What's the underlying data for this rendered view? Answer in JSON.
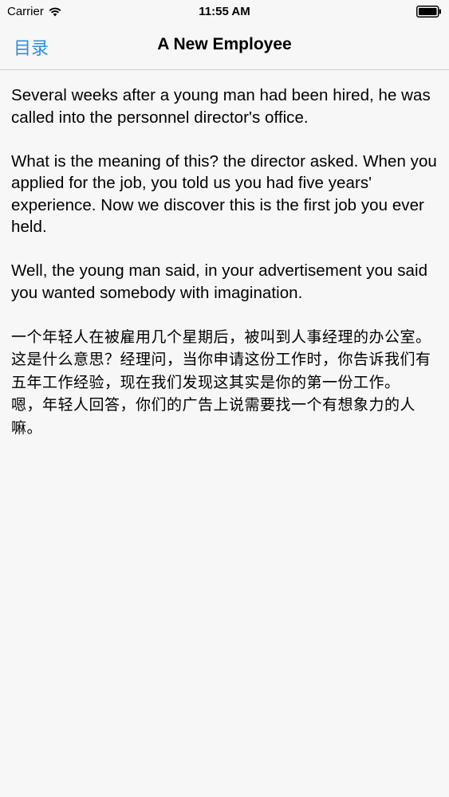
{
  "status_bar": {
    "carrier": "Carrier",
    "time": "11:55 AM",
    "wifi_icon": "wifi-icon",
    "battery_icon": "battery-icon"
  },
  "nav": {
    "back_label": "目录",
    "title": "A New Employee",
    "accent_color": "#2f8fde"
  },
  "article": {
    "english_paragraphs": [
      "Several weeks after a young man had been hired, he was called into the personnel director's office.",
      "What is the meaning of this? the director asked. When you applied for the job, you told us you had five years' experience. Now we discover this is the first job you ever held.",
      "Well, the young man said, in your advertisement you said you wanted somebody with imagination."
    ],
    "chinese_lines": [
      "一个年轻人在被雇用几个星期后，被叫到人事经理的办公室。",
      "这是什么意思？经理问，当你申请这份工作时，你告诉我们有五年工作经验，现在我们发现这其实是你的第一份工作。",
      "嗯，年轻人回答，你们的广告上说需要找一个有想象力的人嘛。"
    ]
  }
}
